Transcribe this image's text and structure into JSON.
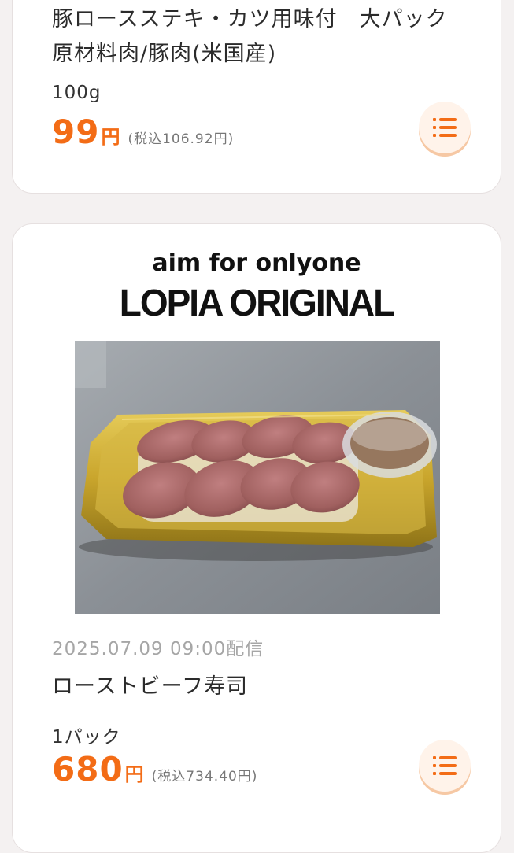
{
  "product1": {
    "title": "豚ロースステキ・カツ用味付　大パック　原材料肉/豚肉(米国産)",
    "quantity": "100g",
    "price": "99",
    "yen": "円",
    "tax_price": "(税込106.92円)"
  },
  "product2": {
    "brand_tagline": "aim for onlyone",
    "brand_logo": "LOPIA ORIGINAL",
    "date": "2025.07.09 09:00配信",
    "title": "ローストビーフ寿司",
    "quantity": "1パック",
    "price": "680",
    "yen": "円",
    "tax_price": "(税込734.40円)"
  },
  "icons": {
    "list_button": "list-icon"
  },
  "colors": {
    "accent": "#f36c16",
    "button_bg": "#fff3ea"
  }
}
